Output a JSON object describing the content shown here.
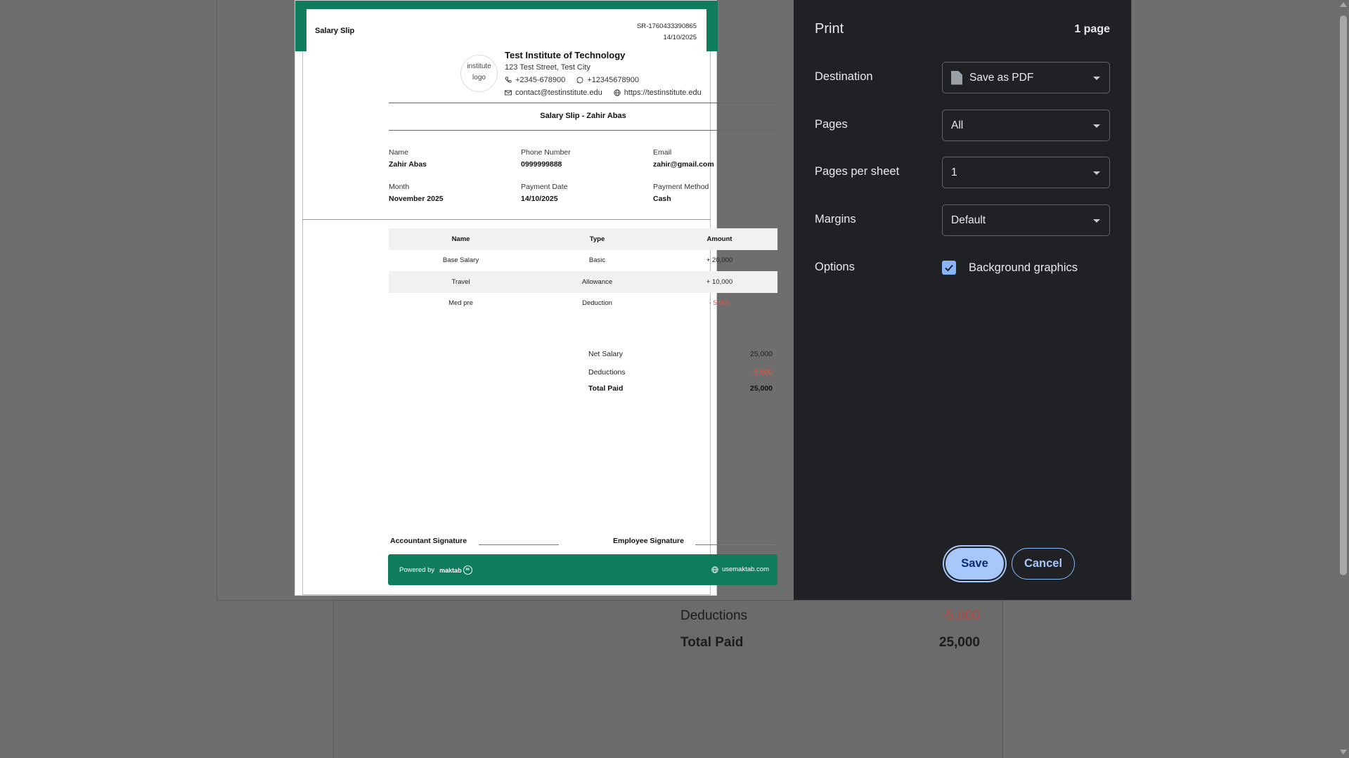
{
  "background_page": {
    "deductions_label": "Deductions",
    "deductions_value": "-5,000",
    "total_paid_label": "Total Paid",
    "total_paid_value": "25,000"
  },
  "slip": {
    "title": "Salary Slip",
    "ref_number": "SR-1760433390865",
    "ref_date": "14/10/2025",
    "logo_alt": "institute logo",
    "institute": {
      "name": "Test Institute of Technology",
      "address": "123 Test Street, Test City",
      "phone": "+2345-678900",
      "whatsapp": "+12345678900",
      "email": "contact@testinstitute.edu",
      "website": "https://testinstitute.edu"
    },
    "subtitle": "Salary Slip - Zahir Abas",
    "fields": {
      "name_label": "Name",
      "name_value": "Zahir Abas",
      "phone_label": "Phone Number",
      "phone_value": "0999999888",
      "email_label": "Email",
      "email_value": "zahir@gmail.com",
      "month_label": "Month",
      "month_value": "November 2025",
      "payment_date_label": "Payment Date",
      "payment_date_value": "14/10/2025",
      "payment_method_label": "Payment Method",
      "payment_method_value": "Cash"
    },
    "table": {
      "headers": [
        "Name",
        "Type",
        "Amount"
      ],
      "rows": [
        [
          "Base Salary",
          "Basic",
          "+ 20,000"
        ],
        [
          "Travel",
          "Allowance",
          "+ 10,000"
        ],
        [
          "Med pre",
          "Deduction",
          "- 5,000"
        ]
      ]
    },
    "summary": {
      "net_label": "Net Salary",
      "net_value": "25,000",
      "deductions_label": "Deductions",
      "deductions_value": "-5,000",
      "total_label": "Total Paid",
      "total_value": "25,000"
    },
    "signatures": {
      "accountant": "Accountant Signature",
      "employee": "Employee Signature"
    },
    "footer": {
      "powered_by": "Powered by",
      "brand": "maktab",
      "site": "usemaktab.com"
    },
    "colors": {
      "accent": "#107c5e",
      "negative": "#e0574a"
    }
  },
  "print_panel": {
    "title": "Print",
    "page_count": "1 page",
    "destination_label": "Destination",
    "destination_value": "Save as PDF",
    "pages_label": "Pages",
    "pages_value": "All",
    "pages_per_sheet_label": "Pages per sheet",
    "pages_per_sheet_value": "1",
    "margins_label": "Margins",
    "margins_value": "Default",
    "options_label": "Options",
    "background_graphics_label": "Background graphics",
    "background_graphics_checked": true,
    "save_button": "Save",
    "cancel_button": "Cancel",
    "colors": {
      "panel_bg": "#202124",
      "primary": "#a8c7fa"
    }
  }
}
